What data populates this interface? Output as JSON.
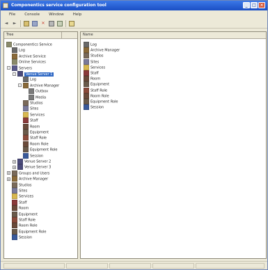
{
  "window": {
    "title": "Componentics service configuration tool",
    "buttons": [
      "_",
      "□",
      "×"
    ]
  },
  "menu": {
    "items": [
      "File",
      "Console",
      "Window",
      "Help"
    ]
  },
  "toolbar": {
    "buttons": [
      "back-icon",
      "forward-icon",
      "up-icon",
      "tree-icon",
      "delete-icon",
      "properties-icon",
      "export-icon",
      "help-icon"
    ]
  },
  "left_pane": {
    "header": "Tree",
    "items": [
      {
        "label": "Componentics Service",
        "icon": "server-icon",
        "color": "#8a8a6a",
        "depth": 0
      },
      {
        "label": "Log",
        "icon": "log-icon",
        "color": "#6a6a6a",
        "depth": 1
      },
      {
        "label": "Archive Service",
        "icon": "archive-icon",
        "color": "#8a6a3a",
        "depth": 1
      },
      {
        "label": "Online Services",
        "icon": "online-icon",
        "color": "#8a8a6a",
        "depth": 1
      },
      {
        "label": "Servers",
        "icon": "servers-icon",
        "color": "#5a5a8a",
        "depth": 1,
        "expander": "-"
      },
      {
        "label": "Venue Server 1",
        "icon": "server-icon",
        "color": "#4a4a7a",
        "depth": 2,
        "expander": "-",
        "selected": true
      },
      {
        "label": "Log",
        "icon": "log-icon",
        "color": "#6a6a6a",
        "depth": 3
      },
      {
        "label": "Archive Manager",
        "icon": "archive-icon",
        "color": "#8a6a3a",
        "depth": 3,
        "expander": "-"
      },
      {
        "label": "Outbox",
        "icon": "outbox-icon",
        "color": "#7a7a7a",
        "depth": 4
      },
      {
        "label": "Media",
        "icon": "media-icon",
        "color": "#7a7a7a",
        "depth": 4
      },
      {
        "label": "Studios",
        "icon": "studios-icon",
        "color": "#7a6a5a",
        "depth": 3
      },
      {
        "label": "Sites",
        "icon": "sites-icon",
        "color": "#7a7a9a",
        "depth": 3
      },
      {
        "label": "Services",
        "icon": "folder-icon",
        "color": "#d8b850",
        "depth": 3
      },
      {
        "label": "Staff",
        "icon": "staff-icon",
        "color": "#8a3a3a",
        "depth": 3
      },
      {
        "label": "Room",
        "icon": "room-icon",
        "color": "#6a4a3a",
        "depth": 3
      },
      {
        "label": "Equipment",
        "icon": "equipment-icon",
        "color": "#6a5a4a",
        "depth": 3
      },
      {
        "label": "Staff Role",
        "icon": "staff-role-icon",
        "color": "#8a4a3a",
        "depth": 3
      },
      {
        "label": "Room Role",
        "icon": "room-role-icon",
        "color": "#6a4a3a",
        "depth": 3
      },
      {
        "label": "Equipment Role",
        "icon": "equipment-role-icon",
        "color": "#6a5a4a",
        "depth": 3
      },
      {
        "label": "Session",
        "icon": "session-icon",
        "color": "#3a5a9a",
        "depth": 3
      },
      {
        "label": "Venue Server 2",
        "icon": "server-icon",
        "color": "#4a4a7a",
        "depth": 2,
        "expander": "+"
      },
      {
        "label": "Venue Server 3",
        "icon": "server-icon",
        "color": "#4a4a7a",
        "depth": 2,
        "expander": "+"
      },
      {
        "label": "Groups and Users",
        "icon": "groups-icon",
        "color": "#7a6a5a",
        "depth": 1,
        "expander": "+"
      },
      {
        "label": "Archive Manager",
        "icon": "archive-icon",
        "color": "#8a6a3a",
        "depth": 1,
        "expander": "+"
      },
      {
        "label": "Studios",
        "icon": "studios-icon",
        "color": "#7a6a5a",
        "depth": 1
      },
      {
        "label": "Sites",
        "icon": "sites-icon",
        "color": "#7a7a9a",
        "depth": 1
      },
      {
        "label": "Services",
        "icon": "folder-icon",
        "color": "#d8b850",
        "depth": 1
      },
      {
        "label": "Staff",
        "icon": "staff-icon",
        "color": "#8a3a3a",
        "depth": 1
      },
      {
        "label": "Room",
        "icon": "room-icon",
        "color": "#6a4a3a",
        "depth": 1
      },
      {
        "label": "Equipment",
        "icon": "equipment-icon",
        "color": "#6a5a4a",
        "depth": 1
      },
      {
        "label": "Staff Role",
        "icon": "staff-role-icon",
        "color": "#8a4a3a",
        "depth": 1
      },
      {
        "label": "Room Role",
        "icon": "room-role-icon",
        "color": "#6a4a3a",
        "depth": 1
      },
      {
        "label": "Equipment Role",
        "icon": "equipment-role-icon",
        "color": "#6a5a4a",
        "depth": 1
      },
      {
        "label": "Session",
        "icon": "session-icon",
        "color": "#3a5a9a",
        "depth": 1
      }
    ]
  },
  "right_pane": {
    "header": "Name",
    "items": [
      {
        "label": "Log",
        "icon": "log-icon",
        "color": "#6a6a6a"
      },
      {
        "label": "Archive Manager",
        "icon": "archive-icon",
        "color": "#8a6a3a"
      },
      {
        "label": "Studios",
        "icon": "studios-icon",
        "color": "#7a6a5a"
      },
      {
        "label": "Sites",
        "icon": "sites-icon",
        "color": "#7a7a9a"
      },
      {
        "label": "Services",
        "icon": "folder-icon",
        "color": "#d8b850"
      },
      {
        "label": "Staff",
        "icon": "staff-icon",
        "color": "#8a3a3a"
      },
      {
        "label": "Room",
        "icon": "room-icon",
        "color": "#6a4a3a"
      },
      {
        "label": "Equipment",
        "icon": "equipment-icon",
        "color": "#6a5a4a"
      },
      {
        "label": "Staff Role",
        "icon": "staff-role-icon",
        "color": "#8a4a3a"
      },
      {
        "label": "Room Role",
        "icon": "room-role-icon",
        "color": "#6a4a3a"
      },
      {
        "label": "Equipment Role",
        "icon": "equipment-role-icon",
        "color": "#6a5a4a"
      },
      {
        "label": "Session",
        "icon": "session-icon",
        "color": "#3a5a9a"
      }
    ]
  },
  "colors": {
    "titlebar": "#2a62d8",
    "selection": "#316ac5",
    "chrome": "#ece9d8"
  }
}
